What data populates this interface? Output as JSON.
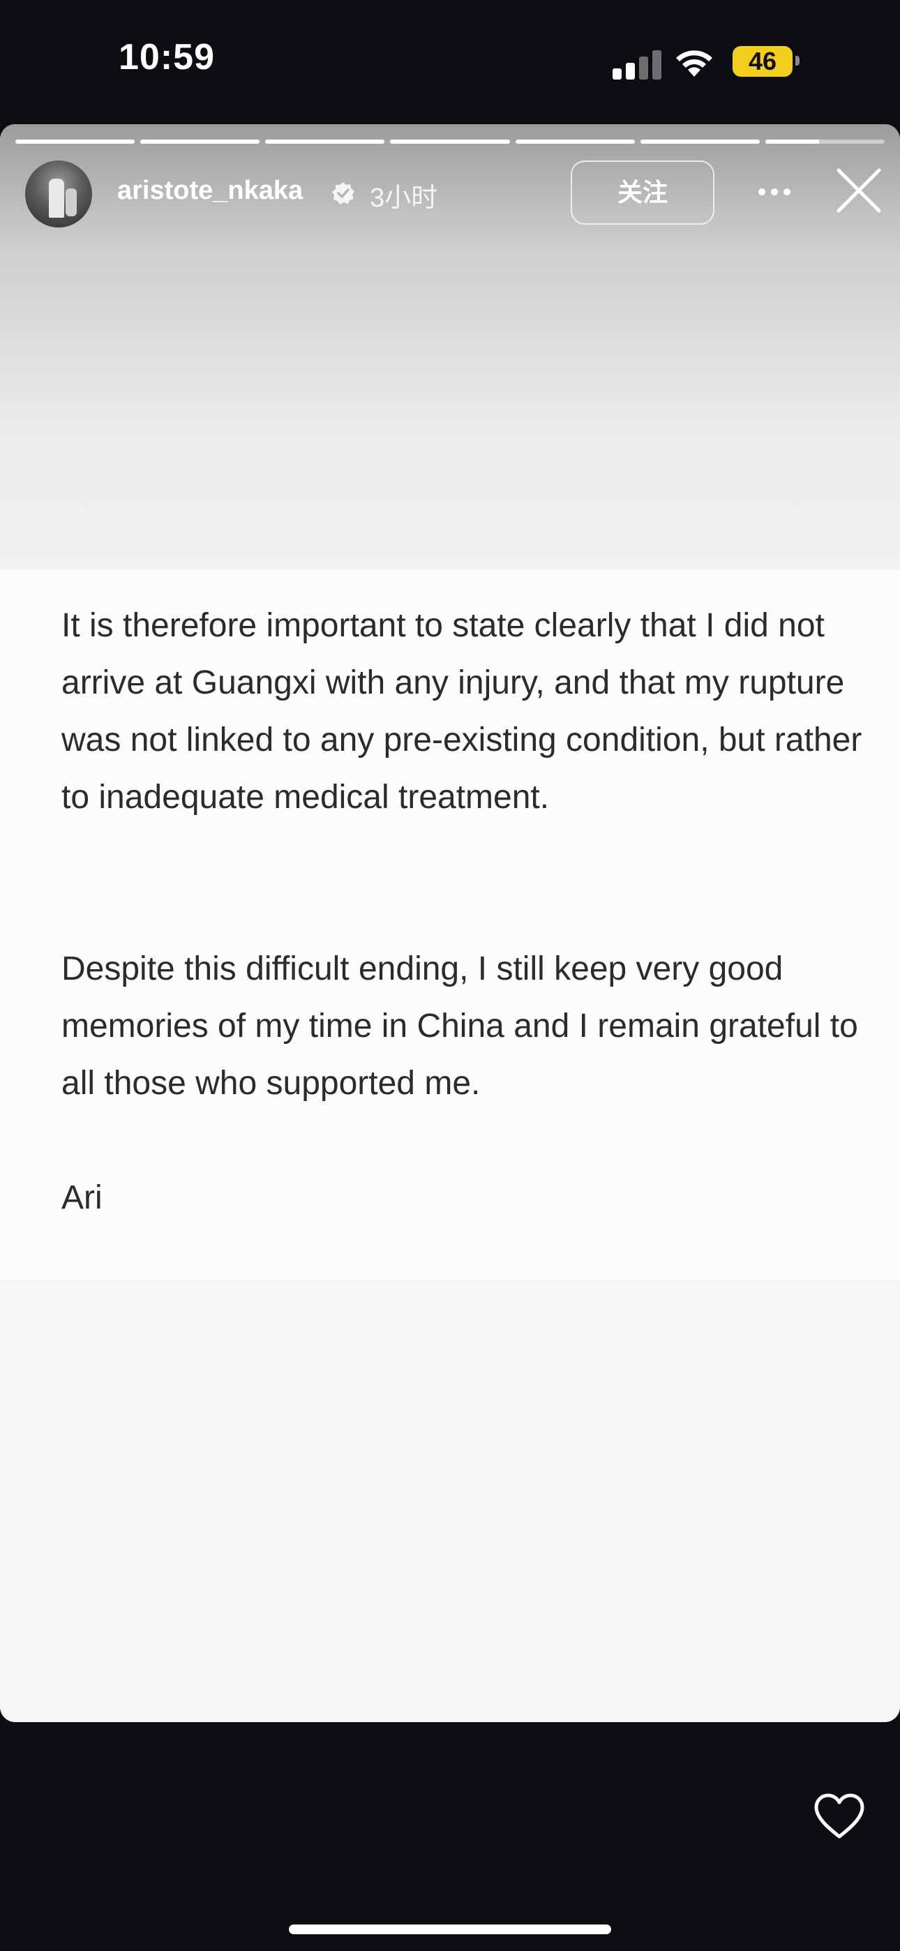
{
  "status_bar": {
    "time": "10:59",
    "battery": "46",
    "battery_color": "#f2cf1d"
  },
  "story": {
    "progress": {
      "segments": 7,
      "completed": 6,
      "current_fraction": 0.45
    },
    "user": {
      "username": "aristote_nkaka",
      "verified": true,
      "time_ago": "3小时"
    },
    "follow_label": "关注",
    "icons": {
      "more": "more-horizontal-icon",
      "close": "close-icon",
      "like": "heart-outline-icon"
    },
    "text": {
      "paragraph1": "It is therefore important to state clearly that I did not arrive at Guangxi with any injury, and that my rupture was not linked to any pre-existing condition, but rather to inadequate medical treatment.",
      "paragraph2": "Despite this difficult ending, I still keep very good memories of my time in China and I remain grateful to all those who supported me.",
      "signature": "Ari"
    }
  },
  "colors": {
    "background": "#0d0e13",
    "text": "#2b2b2b",
    "panel": "#fdfcfa"
  }
}
